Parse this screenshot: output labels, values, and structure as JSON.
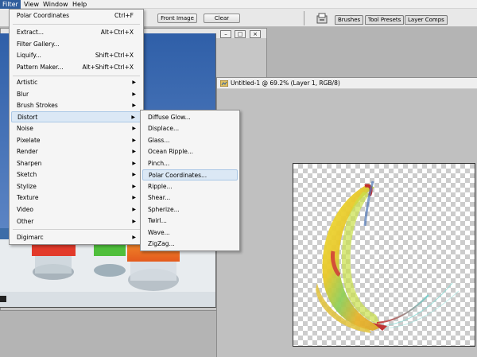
{
  "menubar": {
    "items": [
      "Filter",
      "View",
      "Window",
      "Help"
    ]
  },
  "options_bar": {
    "front_image_label": "Front Image",
    "clear_label": "Clear",
    "palette_tabs": [
      "Brushes",
      "Tool Presets",
      "Layer Comps"
    ]
  },
  "document": {
    "title": "Untitled-1 @ 69.2% (Layer 1, RGB/8)"
  },
  "filter_menu": {
    "last_filter": {
      "label": "Polar Coordinates",
      "shortcut": "Ctrl+F"
    },
    "group1": [
      {
        "label": "Extract...",
        "shortcut": "Alt+Ctrl+X"
      },
      {
        "label": "Filter Gallery...",
        "shortcut": ""
      },
      {
        "label": "Liquify...",
        "shortcut": "Shift+Ctrl+X"
      },
      {
        "label": "Pattern Maker...",
        "shortcut": "Alt+Shift+Ctrl+X"
      }
    ],
    "categories": [
      "Artistic",
      "Blur",
      "Brush Strokes",
      "Distort",
      "Noise",
      "Pixelate",
      "Render",
      "Sharpen",
      "Sketch",
      "Stylize",
      "Texture",
      "Video",
      "Other"
    ],
    "extra": "Digimarc",
    "highlighted": "Distort"
  },
  "distort_submenu": {
    "items": [
      "Diffuse Glow...",
      "Displace...",
      "Glass...",
      "Ocean Ripple...",
      "Pinch...",
      "Polar Coordinates...",
      "Ripple...",
      "Shear...",
      "Spherize...",
      "Twirl...",
      "Wave...",
      "ZigZag..."
    ],
    "highlighted": "Polar Coordinates..."
  },
  "colors": {
    "menu_highlight": "#dbe8f5",
    "menubar_active": "#2f5d9c"
  }
}
